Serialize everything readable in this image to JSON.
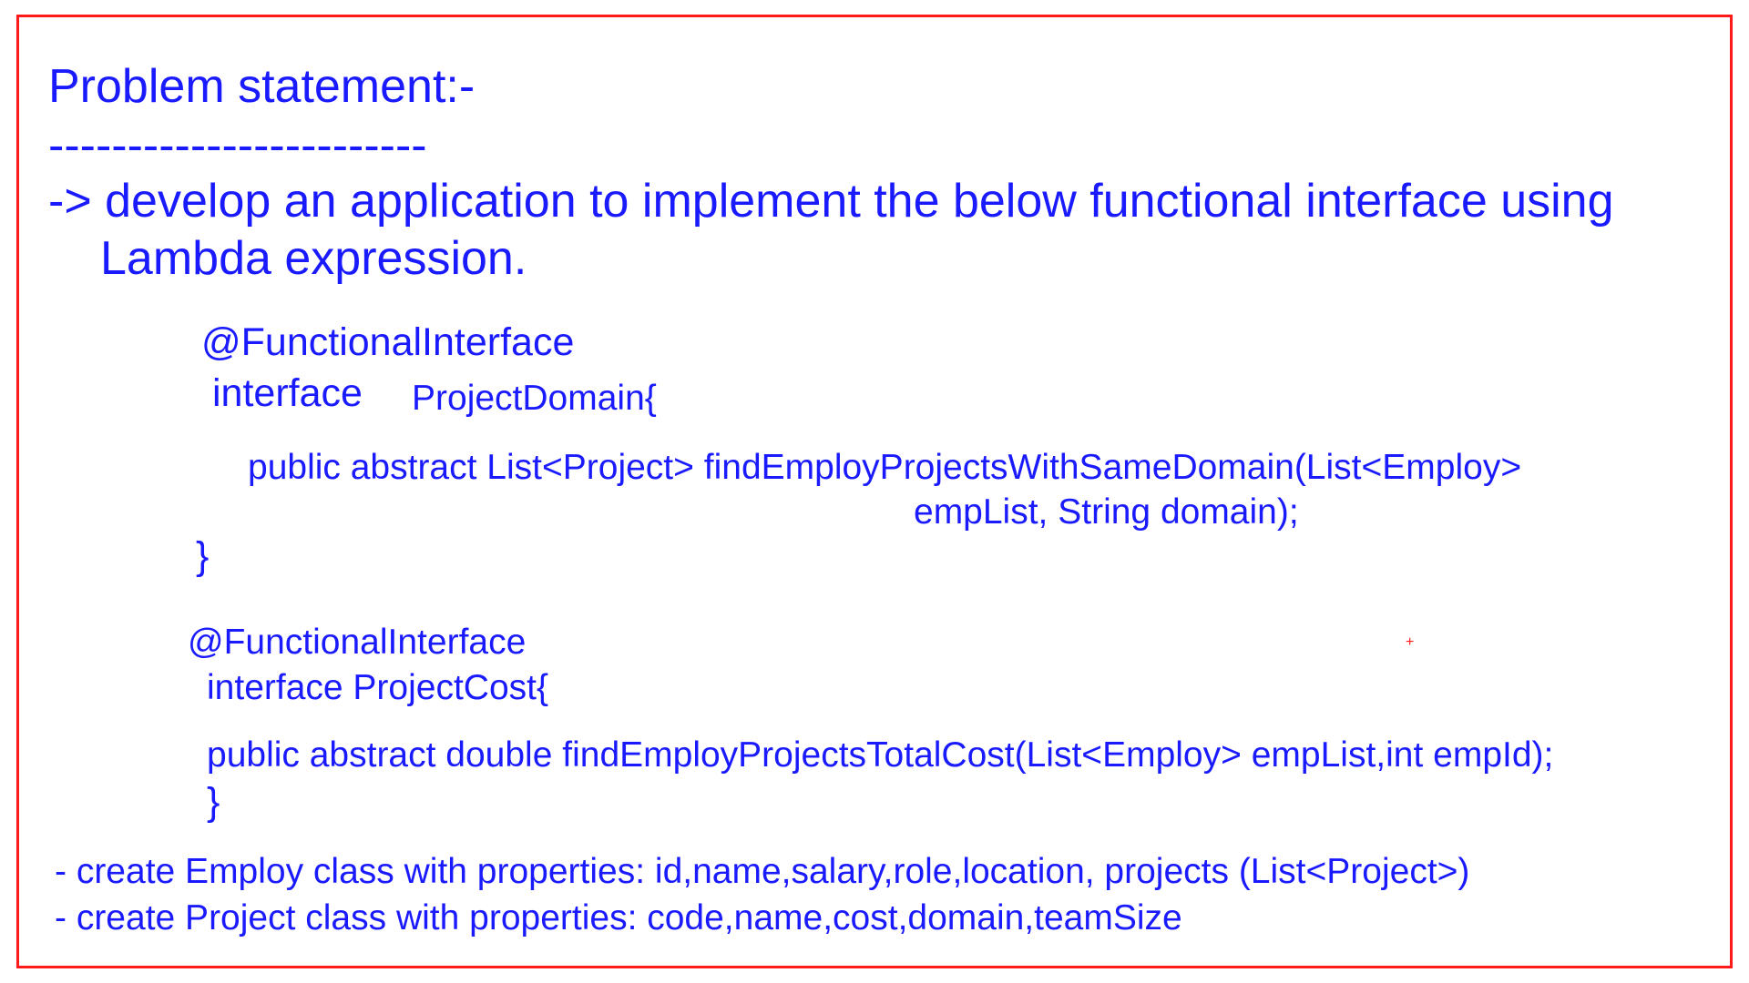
{
  "heading": "Problem statement:-",
  "divider": "------------------------",
  "task": {
    "line1": "-> develop  an application  to implement the below functional interface using",
    "line2": "Lambda expression."
  },
  "interface1": {
    "annotation": "@FunctionalInterface",
    "keyword": "interface",
    "name": "ProjectDomain{",
    "method_line1": "public  abstract  List<Project>   findEmployProjectsWithSameDomain(List<Employ>",
    "method_line2": "empList, String domain);",
    "close": "}"
  },
  "interface2": {
    "annotation": "@FunctionalInterface",
    "declaration": "interface  ProjectCost{",
    "method": "public abstract double  findEmployProjectsTotalCost(List<Employ> empList,int empId);",
    "close": "}"
  },
  "requirements": [
    "- create  Employ class with properties: id,name,salary,role,location, projects (List<Project>)",
    "- create  Project  class  with properties: code,name,cost,domain,teamSize"
  ],
  "marker": "+",
  "colors": {
    "text": "#1a1aff",
    "border": "#ff1a1a",
    "marker": "#ff1a1a"
  }
}
